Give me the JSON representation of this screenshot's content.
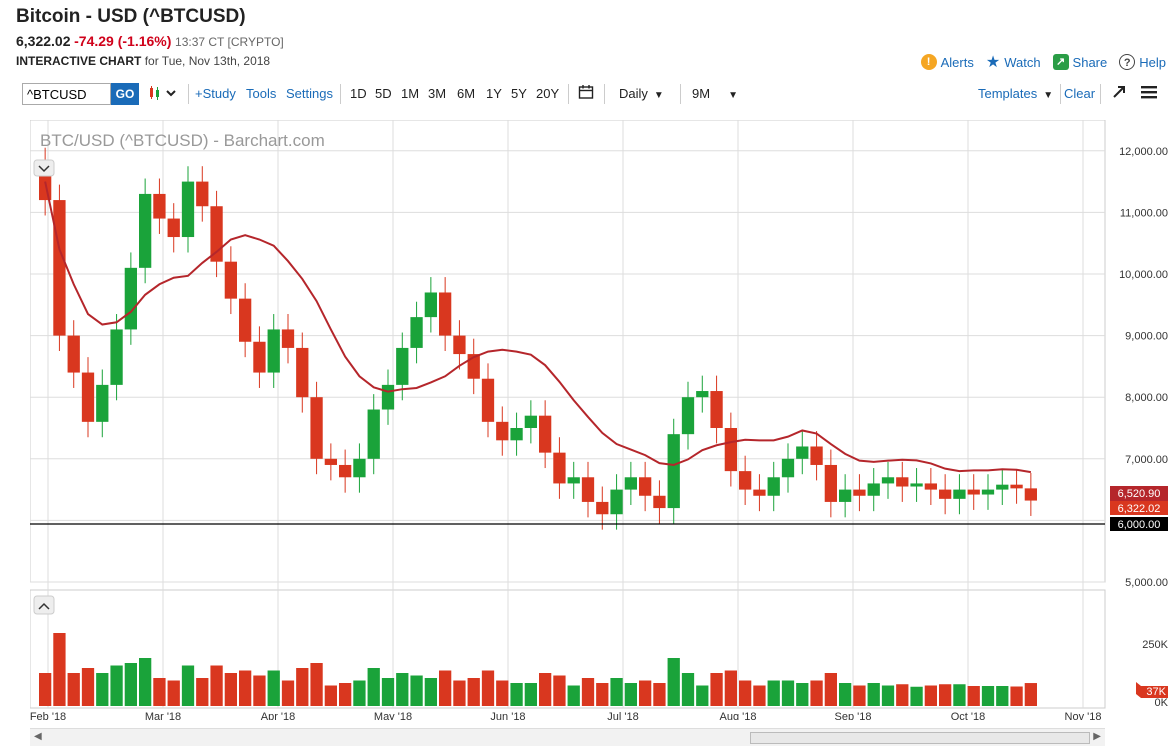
{
  "header": {
    "title": "Bitcoin - USD (^BTCUSD)",
    "last": "6,322.02",
    "change": "-74.29 (-1.16%)",
    "meta": "13:37 CT [CRYPTO]",
    "sub_bold": "INTERACTIVE CHART",
    "sub_rest": "for Tue, Nov 13th, 2018"
  },
  "actions": {
    "alerts": "Alerts",
    "watch": "Watch",
    "share": "Share",
    "help": "Help"
  },
  "toolbar": {
    "symbol_value": "^BTCUSD",
    "go": "GO",
    "study": "+Study",
    "tools": "Tools",
    "settings": "Settings",
    "ranges": [
      "1D",
      "5D",
      "1M",
      "3M",
      "6M",
      "1Y",
      "5Y",
      "20Y"
    ],
    "interval": "Daily",
    "period": "9M",
    "templates": "Templates",
    "clear": "Clear"
  },
  "chart_data": {
    "type": "candlestick",
    "title": "BTC/USD (^BTCUSD) - Barchart.com",
    "x_labels": [
      "Feb '18",
      "Mar '18",
      "Apr '18",
      "May '18",
      "Jun '18",
      "Jul '18",
      "Aug '18",
      "Sep '18",
      "Oct '18",
      "Nov '18"
    ],
    "y_ticks": [
      "12,000.00",
      "11,000.00",
      "10,000.00",
      "9,000.00",
      "8,000.00",
      "7,000.00",
      "6,000.00",
      "5,000.00"
    ],
    "ylim": [
      5000,
      12500
    ],
    "closes": [
      11200,
      9000,
      8400,
      7600,
      8200,
      9100,
      10100,
      11300,
      10900,
      10600,
      11500,
      11100,
      10200,
      9600,
      8900,
      8400,
      9100,
      8800,
      8000,
      7000,
      6900,
      6700,
      7000,
      7800,
      8200,
      8800,
      9300,
      9700,
      9000,
      8700,
      8300,
      7600,
      7300,
      7500,
      7700,
      7100,
      6600,
      6700,
      6300,
      6100,
      6500,
      6700,
      6400,
      6200,
      7400,
      8000,
      8100,
      7500,
      6800,
      6500,
      6400,
      6700,
      7000,
      7200,
      6900,
      6300,
      6500,
      6400,
      6600,
      6700,
      6550,
      6600,
      6500,
      6350,
      6500,
      6420,
      6500,
      6580,
      6520,
      6322
    ],
    "ma_label": "6,520.90",
    "last_label": "6,322.02",
    "hline_label": "6,000.00",
    "volume_ticks": [
      "250K",
      "0K"
    ],
    "volume_last": "37K",
    "colors": {
      "up": "#1aa33a",
      "down": "#d9371f",
      "ma": "#b5262b",
      "hline": "#000000"
    }
  }
}
